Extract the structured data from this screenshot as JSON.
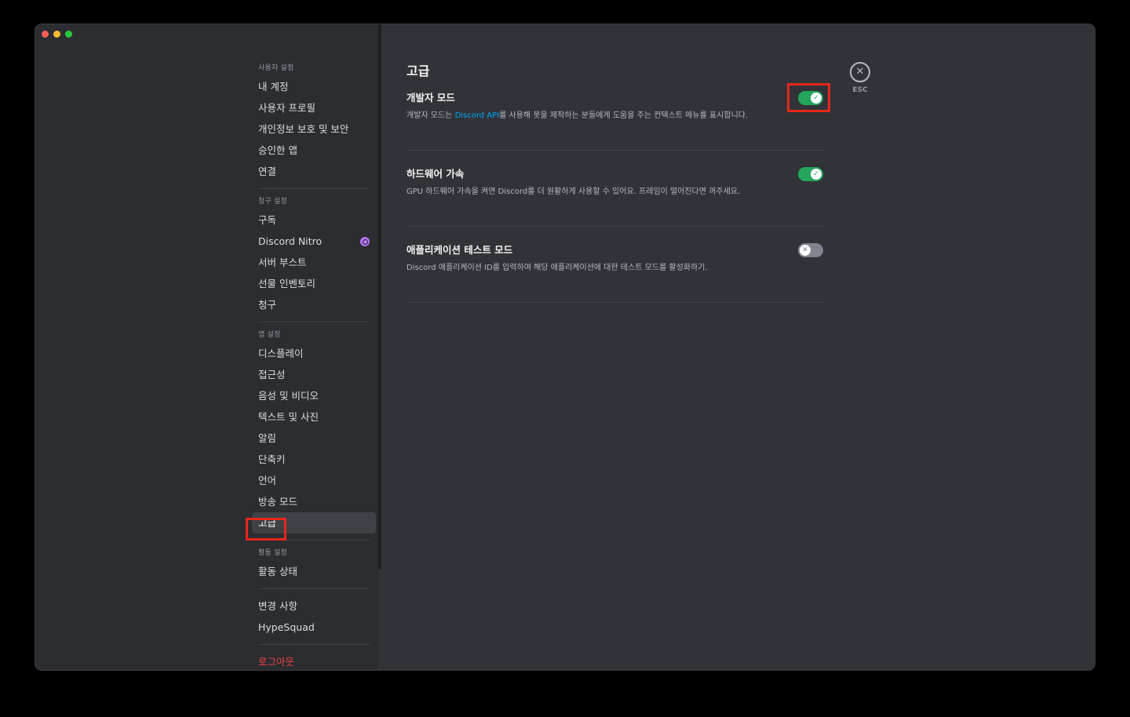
{
  "sidebar": {
    "sections": [
      {
        "header": "사용자 설정",
        "items": [
          "내 계정",
          "사용자 프로필",
          "개인정보 보호 및 보안",
          "승인한 앱",
          "연결"
        ]
      },
      {
        "header": "청구 설정",
        "items": [
          "구독",
          "Discord Nitro",
          "서버 부스트",
          "선물 인벤토리",
          "청구"
        ]
      },
      {
        "header": "앱 설정",
        "items": [
          "디스플레이",
          "접근성",
          "음성 및 비디오",
          "텍스트 및 사진",
          "알림",
          "단축키",
          "언어",
          "방송 모드",
          "고급"
        ]
      },
      {
        "header": "활동 설정",
        "items": [
          "활동 상태"
        ]
      }
    ],
    "extra_items": [
      "변경 사항",
      "HypeSquad"
    ],
    "logout": "로그아웃",
    "active_item": "고급"
  },
  "main": {
    "title": "고급",
    "settings": [
      {
        "title": "개발자 모드",
        "desc_before": "개발자 모드는 ",
        "desc_link": "Discord API",
        "desc_after": "를 사용해 봇을 제작하는 분들에게 도움을 주는 컨텍스트 메뉴를 표시합니다.",
        "enabled": true
      },
      {
        "title": "하드웨어 가속",
        "desc": "GPU 하드웨어 가속을 켜면 Discord를 더 원활하게 사용할 수 있어요. 프레임이 떨어진다면 꺼주세요.",
        "enabled": true
      },
      {
        "title": "애플리케이션 테스트 모드",
        "desc": "Discord 애플리케이션 ID를 입력하여 해당 애플리케이션에 대한 테스트 모드를 활성화하기.",
        "enabled": false
      }
    ]
  },
  "close": {
    "label": "ESC"
  },
  "colors": {
    "toggle_on": "#23a55a",
    "toggle_off": "#80848e",
    "link": "#00a8fc",
    "logout": "#f23f43",
    "highlight": "#e8271b"
  }
}
